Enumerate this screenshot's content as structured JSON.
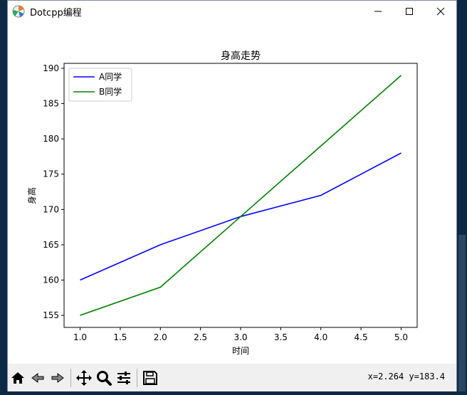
{
  "window": {
    "title": "Dotcpp编程"
  },
  "toolbar": {
    "coord_readout": "x=2.264 y=183.4"
  },
  "colors": {
    "series_a": "#0000ff",
    "series_b": "#008000"
  },
  "chart_data": {
    "type": "line",
    "title": "身高走势",
    "xlabel": "时间",
    "ylabel": "身高",
    "x": [
      1,
      2,
      3,
      4,
      5
    ],
    "series": [
      {
        "name": "A同学",
        "color": "#0000ff",
        "values": [
          160,
          165,
          169,
          172,
          178
        ]
      },
      {
        "name": "B同学",
        "color": "#008000",
        "values": [
          155,
          159,
          169,
          179,
          189
        ]
      }
    ],
    "xlim": [
      0.8,
      5.2
    ],
    "ylim": [
      153.3,
      190.7
    ],
    "xticks": [
      1.0,
      1.5,
      2.0,
      2.5,
      3.0,
      3.5,
      4.0,
      4.5,
      5.0
    ],
    "xtick_labels": [
      "1.0",
      "1.5",
      "2.0",
      "2.5",
      "3.0",
      "3.5",
      "4.0",
      "4.5",
      "5.0"
    ],
    "yticks": [
      155,
      160,
      165,
      170,
      175,
      180,
      185,
      190
    ],
    "ytick_labels": [
      "155",
      "160",
      "165",
      "170",
      "175",
      "180",
      "185",
      "190"
    ],
    "grid": false,
    "legend": "upper-left"
  }
}
